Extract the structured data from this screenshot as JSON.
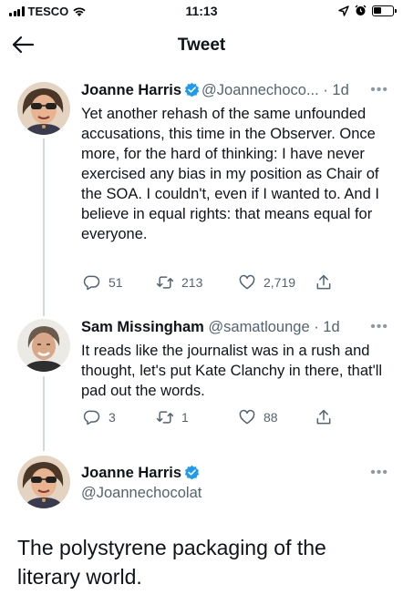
{
  "status_bar": {
    "carrier": "TESCO",
    "time": "11:13"
  },
  "nav": {
    "title": "Tweet"
  },
  "thread": [
    {
      "name": "Joanne Harris",
      "handle": "@Joannechoco...",
      "time": "· 1d",
      "text": "Yet another rehash of the same unfounded accusations, this time in the Observer. Once more, for the hard of thinking: I have never exercised any bias in my position as Chair of the SOA. I couldn't, even if I wanted to. And I believe in equal rights: that means equal for everyone.",
      "replies": "51",
      "retweets": "213",
      "likes": "2,719"
    },
    {
      "name": "Sam Missingham",
      "handle": "@samatlounge",
      "time": "· 1d",
      "text": "It reads like the journalist was in a rush and thought, let's put Kate Clanchy in there, that'll pad out the words.",
      "replies": "3",
      "retweets": "1",
      "likes": "88"
    }
  ],
  "main_tweet": {
    "name": "Joanne Harris",
    "handle": "@Joannechocolat",
    "text": "The polystyrene packaging of the literary world."
  },
  "colors": {
    "verified": "#1d9bf0",
    "secondary_text": "#536471"
  },
  "icons": [
    "signal-bars-icon",
    "wifi-icon",
    "location-arrow-icon",
    "alarm-icon",
    "battery-icon",
    "back-arrow-icon",
    "verified-badge-icon",
    "more-icon",
    "reply-icon",
    "retweet-icon",
    "like-icon",
    "share-icon"
  ]
}
